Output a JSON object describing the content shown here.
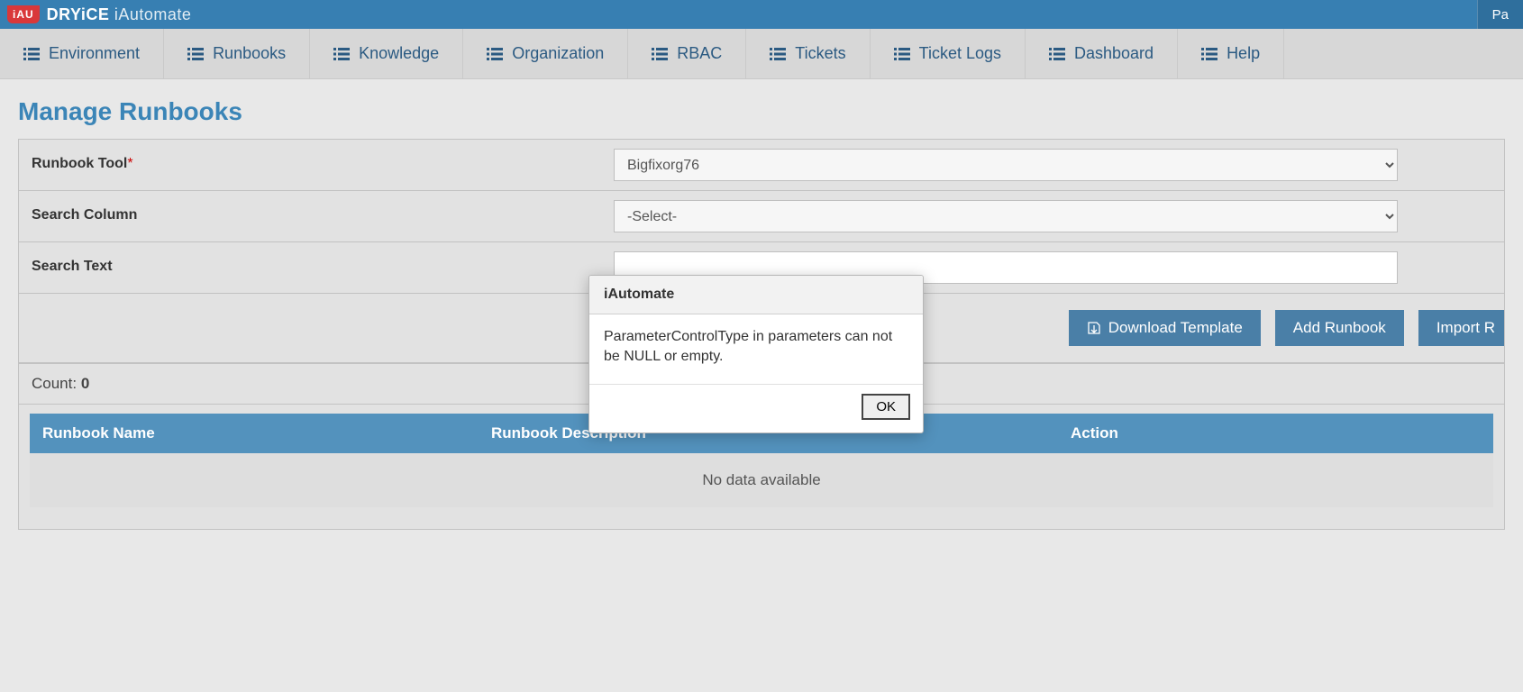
{
  "brand": {
    "badge": "iAU",
    "name": "DRYiCE",
    "product": "iAutomate"
  },
  "topbar_right": "Pa",
  "nav": [
    {
      "label": "Environment"
    },
    {
      "label": "Runbooks"
    },
    {
      "label": "Knowledge"
    },
    {
      "label": "Organization"
    },
    {
      "label": "RBAC"
    },
    {
      "label": "Tickets"
    },
    {
      "label": "Ticket Logs"
    },
    {
      "label": "Dashboard"
    },
    {
      "label": "Help"
    }
  ],
  "page_title": "Manage Runbooks",
  "form": {
    "runbook_tool_label": "Runbook Tool",
    "runbook_tool_value": "Bigfixorg76",
    "search_column_label": "Search Column",
    "search_column_value": "-Select-",
    "search_text_label": "Search Text",
    "search_text_value": ""
  },
  "buttons": {
    "download_template": "Download Template",
    "add_runbook": "Add Runbook",
    "import_runbook": "Import R"
  },
  "count": {
    "label": "Count: ",
    "value": "0"
  },
  "table": {
    "columns": [
      "Runbook Name",
      "Runbook Description",
      "Action"
    ],
    "no_data": "No data available"
  },
  "modal": {
    "title": "iAutomate",
    "message": "ParameterControlType in parameters can not be NULL or empty.",
    "ok": "OK"
  }
}
